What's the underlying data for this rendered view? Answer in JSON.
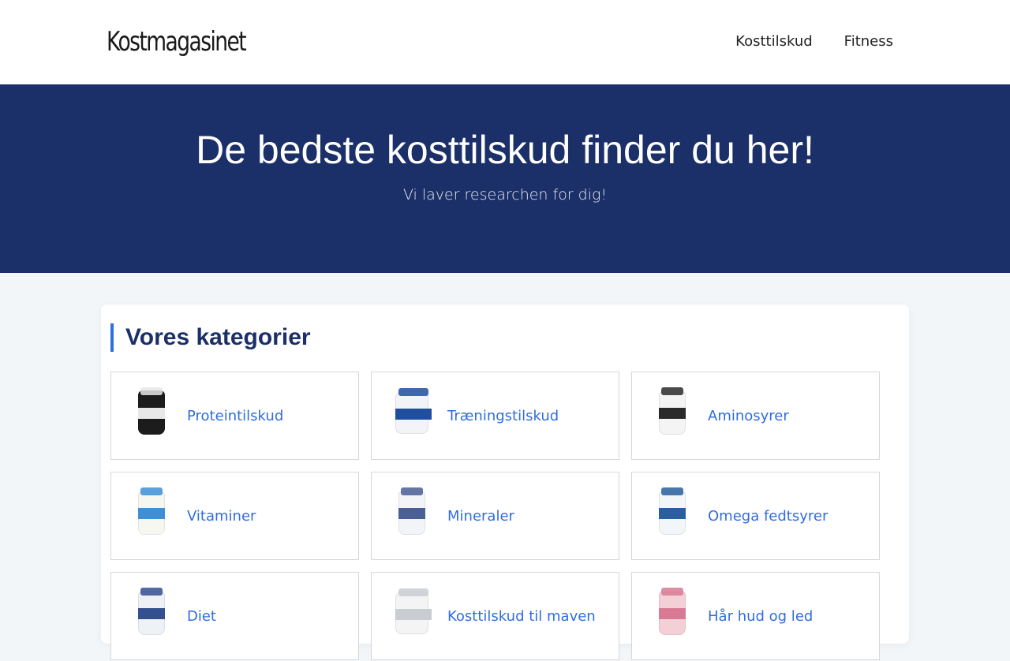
{
  "header": {
    "logo": "Kostmagasinet",
    "nav": [
      {
        "label": "Kosttilskud"
      },
      {
        "label": "Fitness"
      }
    ]
  },
  "hero": {
    "title": "De bedste kosttilskud finder du her!",
    "subtitle": "Vi laver researchen for dig!"
  },
  "categories": {
    "title": "Vores kategorier",
    "items": [
      {
        "label": "Proteintilskud",
        "icon": "protein-jar-icon",
        "jar_color": "#1c1c1c",
        "band_color": "#e8e8e8"
      },
      {
        "label": "Træningstilskud",
        "icon": "training-supplement-jar-icon",
        "jar_color": "#f2f4f7",
        "band_color": "#1f4f9e"
      },
      {
        "label": "Aminosyrer",
        "icon": "amino-acid-jar-icon",
        "jar_color": "#f4f4f4",
        "band_color": "#2a2a2a"
      },
      {
        "label": "Vitaminer",
        "icon": "vitamin-jar-icon",
        "jar_color": "#f7f7f2",
        "band_color": "#3f8fd6"
      },
      {
        "label": "Mineraler",
        "icon": "mineral-jar-icon",
        "jar_color": "#f2f4f8",
        "band_color": "#4a5f94"
      },
      {
        "label": "Omega fedtsyrer",
        "icon": "omega-jar-icon",
        "jar_color": "#f2f6f9",
        "band_color": "#2a5f9e"
      },
      {
        "label": "Diet",
        "icon": "diet-jar-icon",
        "jar_color": "#eef1f6",
        "band_color": "#34508f"
      },
      {
        "label": "Kosttilskud til maven",
        "icon": "stomach-supplement-jar-icon",
        "jar_color": "#f4f4f4",
        "band_color": "#c9cdd2"
      },
      {
        "label": "Hår hud og led",
        "icon": "hair-skin-joint-jar-icon",
        "jar_color": "#f3d0d8",
        "band_color": "#d87a94"
      }
    ]
  },
  "colors": {
    "hero_background": "#1b2f68",
    "accent": "#2f6de1",
    "page_background": "#f3f6f9"
  }
}
